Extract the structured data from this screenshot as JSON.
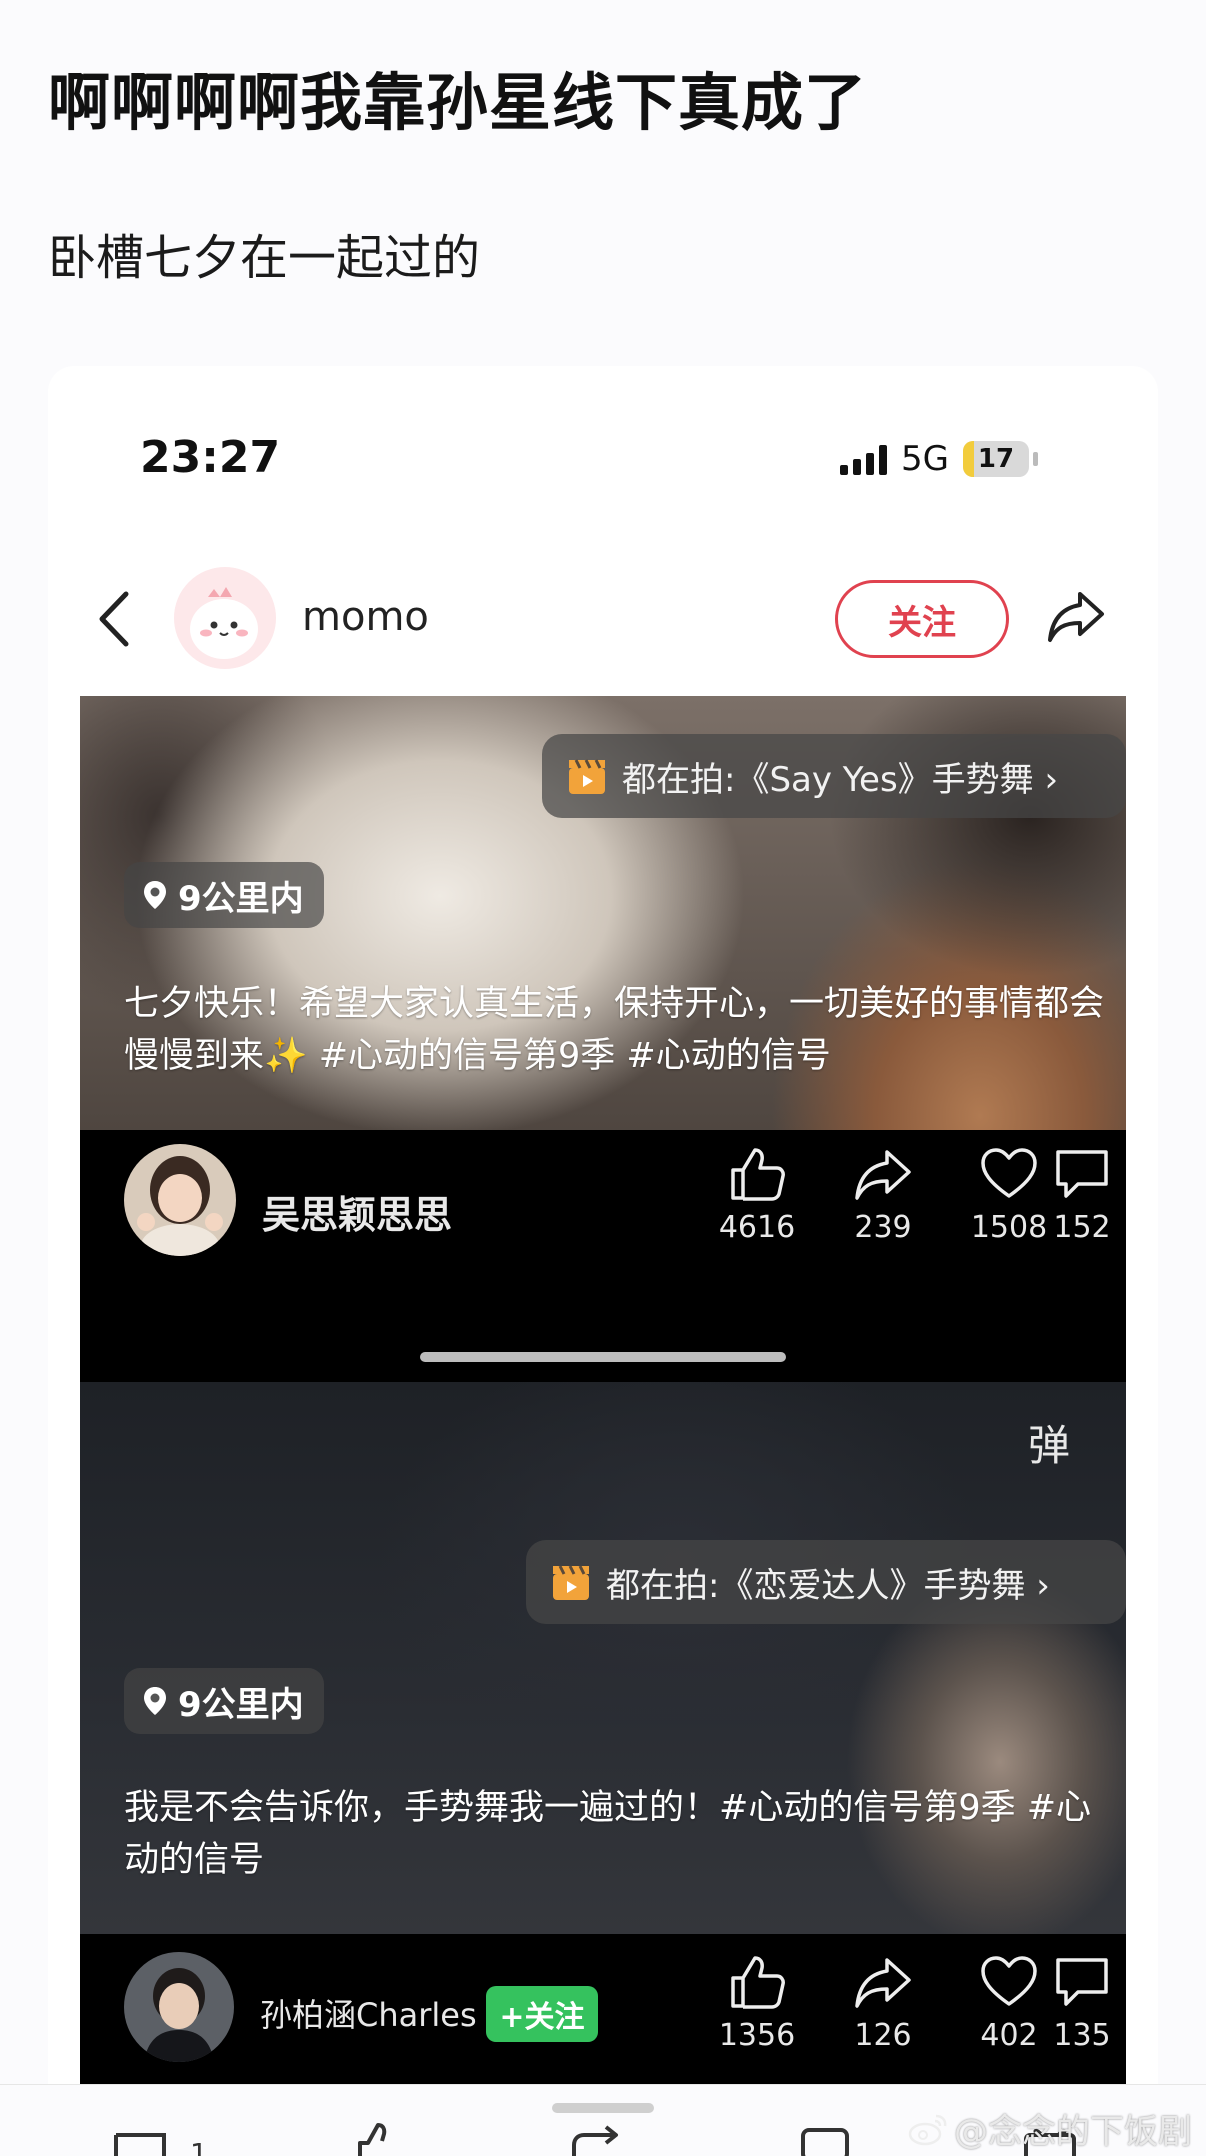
{
  "post": {
    "title": "啊啊啊啊我靠孙星线下真成了",
    "body": "卧槽七夕在一起过的"
  },
  "status_bar": {
    "time": "23:27",
    "network": "5G",
    "battery": "17",
    "battery_level": 0.17
  },
  "header": {
    "username": "momo",
    "follow_label": "关注"
  },
  "videos": [
    {
      "effect_chip": "都在拍:《Say Yes》手势舞 ›",
      "location": "9公里内",
      "caption": "七夕快乐！希望大家认真生活，保持开心，一切美好的事情都会慢慢到来✨ #心动的信号第9季 #心动的信号",
      "creator": "吴思颖思思",
      "likes": "4616",
      "shares": "239",
      "favorites": "1508",
      "comments": "152"
    },
    {
      "danmaku_label": "弹",
      "effect_chip": "都在拍:《恋爱达人》手势舞 ›",
      "location": "9公里内",
      "caption": "我是不会告诉你，手势舞我一遍过的！#心动的信号第9季 #心动的信号",
      "creator": "孙柏涵Charles",
      "follow_label": "+关注",
      "likes": "1356",
      "shares": "126",
      "favorites": "402",
      "comments": "135"
    }
  ],
  "bottom_bar": {
    "comment_count": "1"
  },
  "watermark": "@念念的下饭剧",
  "colors": {
    "follow_red": "#e0424f",
    "follow_green": "#35c25e",
    "battery_yellow": "#f2cc3c"
  },
  "icons": [
    "back-icon",
    "share-icon",
    "clapper-icon",
    "location-pin-icon",
    "like-icon",
    "repost-icon",
    "heart-icon",
    "comment-icon",
    "weibo-icon"
  ]
}
